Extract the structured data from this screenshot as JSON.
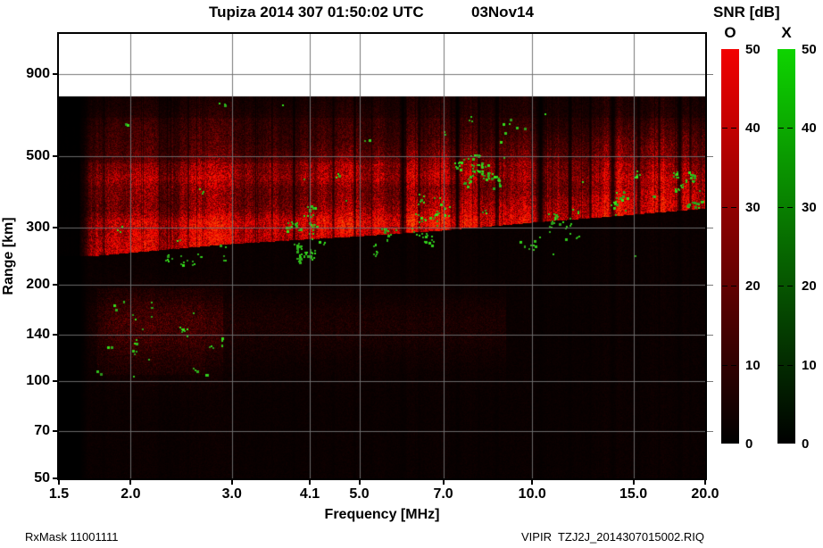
{
  "header": {
    "title": "Tupiza 2014 307 01:50:02 UTC",
    "date": "03Nov14"
  },
  "colorbar": {
    "title": "SNR [dB]",
    "o_label": "O",
    "x_label": "X",
    "min": 0,
    "max": 50,
    "ticks": [
      0,
      10,
      20,
      30,
      40,
      50
    ],
    "o_top_color": "#f20000",
    "x_top_color": "#0ed400",
    "bottom_color": "#000000"
  },
  "footer": {
    "left": "RxMask 11001111",
    "right": "VIPIR  TZJ2J_2014307015002.RIQ"
  },
  "chart_data": {
    "type": "heatmap",
    "title": "Tupiza 2014 307 01:50:02 UTC",
    "date_label": "03Nov14",
    "xlabel": "Frequency [MHz]",
    "ylabel": "Range [km]",
    "xscale": "log",
    "yscale": "log",
    "xlim": [
      1.5,
      20
    ],
    "ylim": [
      50,
      1200
    ],
    "xticks": [
      1.5,
      2.0,
      3.0,
      4.1,
      5.0,
      7.0,
      10.0,
      15.0,
      20.0
    ],
    "xtick_labels": [
      "1.5",
      "2.0",
      "3.0",
      "4.1",
      "5.0",
      "7.0",
      "10.0",
      "15.0",
      "20.0"
    ],
    "yticks": [
      50,
      70,
      100,
      140,
      200,
      300,
      500,
      900
    ],
    "ytick_labels": [
      "50",
      "70",
      "100",
      "140",
      "200",
      "300",
      "500",
      "900"
    ],
    "grid": true,
    "grid_color": "#707070",
    "snr_range_db": [
      0,
      50
    ],
    "o_mode_color": "#ff0000",
    "x_mode_color": "#22cc22",
    "background_color": "#000000",
    "data_top_km": 770,
    "echo_lower_boundary_f_km": [
      [
        1.7,
        245
      ],
      [
        3,
        268
      ],
      [
        5,
        283
      ],
      [
        7,
        295
      ],
      [
        10,
        312
      ],
      [
        14,
        327
      ],
      [
        20,
        345
      ]
    ],
    "echo_upper_fade_km": 470,
    "e_region_noise": {
      "f_mhz": [
        1.7,
        3.0
      ],
      "km": [
        100,
        195
      ]
    },
    "rfi_notches": [
      {
        "f": 2.1,
        "w": 1,
        "d": 0.5
      },
      {
        "f": 2.35,
        "w": 1,
        "d": 0.5
      },
      {
        "f": 2.6,
        "w": 1,
        "d": 0.5
      },
      {
        "f": 3.3,
        "w": 1,
        "d": 0.45
      },
      {
        "f": 3.85,
        "w": 2,
        "d": 0.25
      },
      {
        "f": 4.5,
        "w": 2,
        "d": 0.3
      },
      {
        "f": 4.9,
        "w": 2,
        "d": 0.3
      },
      {
        "f": 5.95,
        "w": 5,
        "d": 0.12
      },
      {
        "f": 6.35,
        "w": 2,
        "d": 0.3
      },
      {
        "f": 6.9,
        "w": 1,
        "d": 0.4
      },
      {
        "f": 7.4,
        "w": 3,
        "d": 0.15
      },
      {
        "f": 8.05,
        "w": 2,
        "d": 0.25
      },
      {
        "f": 8.65,
        "w": 3,
        "d": 0.2
      },
      {
        "f": 10.3,
        "w": 6,
        "d": 0.1
      },
      {
        "f": 11.6,
        "w": 3,
        "d": 0.2
      },
      {
        "f": 12.6,
        "w": 2,
        "d": 0.3
      },
      {
        "f": 13.8,
        "w": 5,
        "d": 0.15
      },
      {
        "f": 15.3,
        "w": 3,
        "d": 0.25
      },
      {
        "f": 16.6,
        "w": 2,
        "d": 0.3
      },
      {
        "f": 18.0,
        "w": 4,
        "d": 0.2
      },
      {
        "f": 18.8,
        "w": 2,
        "d": 0.35
      }
    ],
    "x_mode_clusters": [
      {
        "f": [
          3.75,
          4.2
        ],
        "km": [
          238,
          360
        ],
        "n": 26
      },
      {
        "f": [
          3.9,
          4.15
        ],
        "km": [
          238,
          258
        ],
        "n": 10
      },
      {
        "f": [
          6.3,
          7.1
        ],
        "km": [
          260,
          370
        ],
        "n": 20
      },
      {
        "f": [
          7.4,
          8.9
        ],
        "km": [
          405,
          500
        ],
        "n": 34
      },
      {
        "f": [
          8.6,
          9.4
        ],
        "km": [
          545,
          665
        ],
        "n": 5
      },
      {
        "f": [
          10.6,
          12.2
        ],
        "km": [
          270,
          340
        ],
        "n": 14
      },
      {
        "f": [
          13.5,
          14.6
        ],
        "km": [
          330,
          400
        ],
        "n": 8
      },
      {
        "f": [
          15.0,
          15.6
        ],
        "km": [
          430,
          448
        ],
        "n": 3
      },
      {
        "f": [
          17.5,
          19.9
        ],
        "km": [
          345,
          445
        ],
        "n": 18
      },
      {
        "f": [
          1.72,
          2.9
        ],
        "km": [
          100,
          180
        ],
        "n": 22
      },
      {
        "f": [
          2.2,
          3.0
        ],
        "km": [
          230,
          252
        ],
        "n": 6
      },
      {
        "f": [
          5.3,
          6.2
        ],
        "km": [
          250,
          300
        ],
        "n": 8
      },
      {
        "f": [
          9.5,
          10.5
        ],
        "km": [
          255,
          285
        ],
        "n": 6
      },
      {
        "f": [
          1.9,
          19.0
        ],
        "km": [
          240,
          740
        ],
        "n": 25
      }
    ]
  }
}
